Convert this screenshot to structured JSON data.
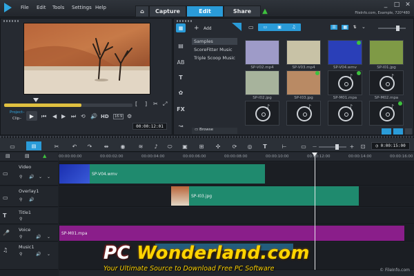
{
  "menu": {
    "file": "File",
    "edit": "Edit",
    "tools": "Tools",
    "settings": "Settings",
    "help": "Help"
  },
  "tabs": {
    "capture": "Capture",
    "edit": "Edit",
    "share": "Share"
  },
  "window": {
    "info": "FileInfo.com, Example, 720*480",
    "minimize": "_",
    "maximize": "□",
    "close": "✕"
  },
  "player": {
    "project_label": "Project–",
    "clip_label": "Clip–",
    "hd": "HD",
    "ratio": "16:9",
    "timecode": "00:00:12:01",
    "progress": 0.6
  },
  "library": {
    "add_label": "Add",
    "browse_label": "Browse",
    "folders": [
      "Samples",
      "ScoreFitter Music",
      "Triple Scoop Music"
    ],
    "items": [
      {
        "name": "SP-V02.mp4",
        "kind": "video",
        "bg": "#9e9bc8",
        "checked": false
      },
      {
        "name": "SP-V03.mp4",
        "kind": "video",
        "bg": "#c8c2a6",
        "checked": false
      },
      {
        "name": "SP-V04.wmv",
        "kind": "video",
        "bg": "#2a3fb8",
        "checked": true
      },
      {
        "name": "SP-I01.jpg",
        "kind": "image",
        "bg": "#7f9a46",
        "checked": false
      },
      {
        "name": "SP-I02.jpg",
        "kind": "image",
        "bg": "#a7b39c",
        "checked": false
      },
      {
        "name": "SP-I03.jpg",
        "kind": "image",
        "bg": "#b98a64",
        "checked": true
      },
      {
        "name": "SP-M01.mpa",
        "kind": "audio",
        "bg": "#1c1f24",
        "checked": true
      },
      {
        "name": "SP-M02.mpa",
        "kind": "audio",
        "bg": "#1c1f24",
        "checked": false
      },
      {
        "name": "",
        "kind": "audio",
        "bg": "#1c1f24",
        "checked": false
      },
      {
        "name": "",
        "kind": "audio",
        "bg": "#1c1f24",
        "checked": false
      },
      {
        "name": "",
        "kind": "audio",
        "bg": "#1c1f24",
        "checked": false
      },
      {
        "name": "",
        "kind": "audio",
        "bg": "#1c1f24",
        "checked": true
      }
    ]
  },
  "timeline": {
    "timecode": "0:00:15:00",
    "ruler": [
      "00:00:00:00",
      "00:00:02:00",
      "00:00:04:00",
      "00:00:06:00",
      "00:00:08:00",
      "00:00:10:00",
      "00:00:12:00",
      "00:00:14:00",
      "00:00:16:00"
    ],
    "tracks": [
      "Video",
      "Overlay1",
      "Title1",
      "Voice",
      "Music1"
    ],
    "clips": {
      "video": "SP-V04.wmv",
      "overlay": "SP-I03.jpg",
      "voice": "SP-M01.mpa"
    }
  },
  "watermark": {
    "part1": "PC ",
    "part2": "Wonderland.com",
    "tagline": "Your Ultimate Source to Download Free PC Software",
    "credit": "© FileInfo.com"
  },
  "colors": {
    "accent": "#2a9bd8",
    "video_clip": "#1f8a6e",
    "voice_clip": "#8a1e8a",
    "overlay_clip": "#1f8a6e"
  }
}
